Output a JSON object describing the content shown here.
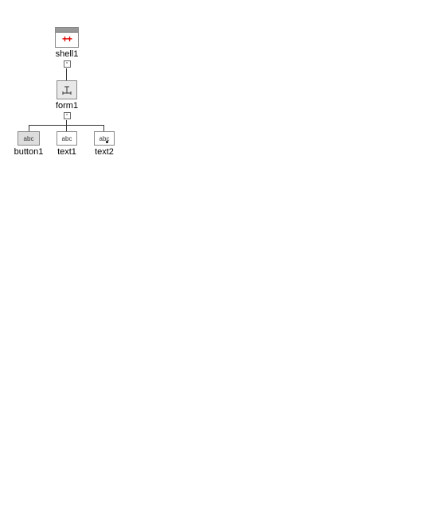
{
  "tree": {
    "root": {
      "id": "shell1",
      "label": "shell1",
      "type": "shell",
      "expanded": true,
      "icon_text": "++",
      "children": [
        {
          "id": "form1",
          "label": "form1",
          "type": "form",
          "expanded": true,
          "children": [
            {
              "id": "button1",
              "label": "button1",
              "type": "button",
              "icon_text": "abc"
            },
            {
              "id": "text1",
              "label": "text1",
              "type": "text",
              "icon_text": "abc"
            },
            {
              "id": "text2",
              "label": "text2",
              "type": "text",
              "icon_text": "abc",
              "multiline": true
            }
          ]
        }
      ]
    }
  }
}
